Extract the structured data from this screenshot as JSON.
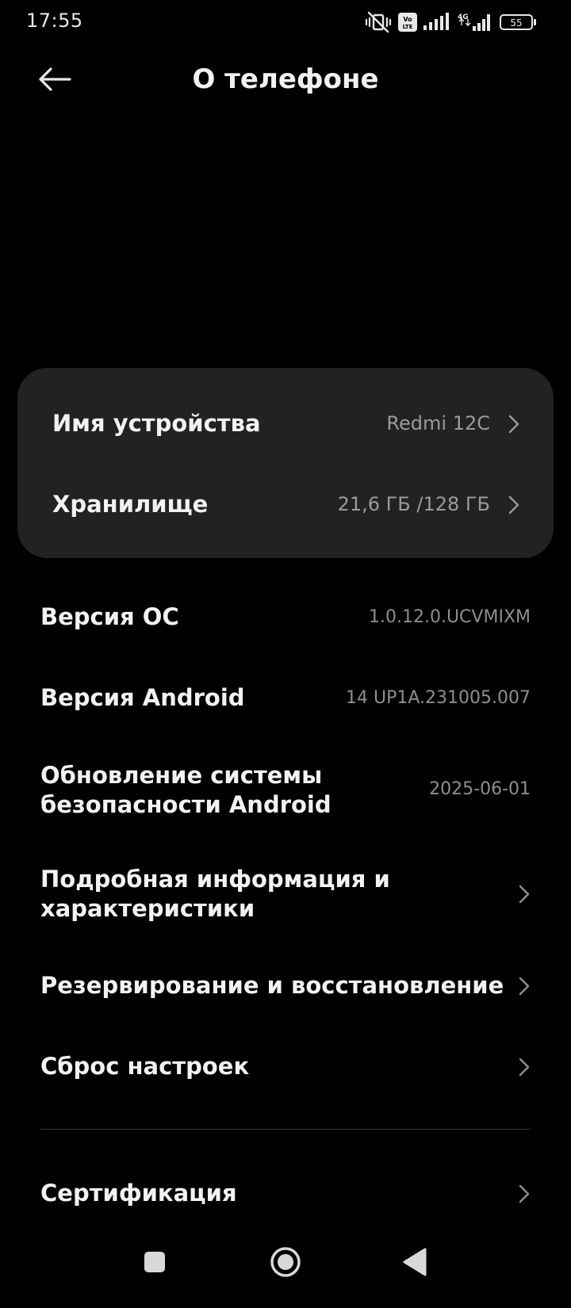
{
  "status_bar": {
    "time": "17:55",
    "icons": [
      "vibrate-mute-icon",
      "volte-icon",
      "signal-icon",
      "4g-signal-icon",
      "battery-icon"
    ],
    "volte_label": "Vo LTE",
    "network_label": "4G",
    "battery": "55"
  },
  "header": {
    "back_icon": "arrow-left-icon",
    "title": "О телефоне"
  },
  "card": {
    "device_name_label": "Имя устройства",
    "device_name_value": "Redmi 12C",
    "storage_label": "Хранилище",
    "storage_value": "21,6 ГБ /128 ГБ"
  },
  "info": {
    "os_version_label": "Версия ОС",
    "os_version_value": "1.0.12.0.UCVMIXM",
    "android_version_label": "Версия Android",
    "android_version_value": "14 UP1A.231005.007",
    "security_update_label_line1": "Обновление системы",
    "security_update_label_line2": "безопасности Android",
    "security_update_value": "2025-06-01"
  },
  "links": {
    "details_line1": "Подробная информация и",
    "details_line2": "характеристики",
    "backup": "Резервирование и восстановление",
    "reset": "Сброс настроек",
    "certification": "Сертификация"
  },
  "navbar": {
    "icons": [
      "recents-square-icon",
      "home-circle-icon",
      "back-triangle-icon"
    ]
  },
  "colors": {
    "background": "#000000",
    "card": "#222222",
    "text_primary": "#f2f2f2",
    "text_secondary": "#9a9a9a"
  }
}
